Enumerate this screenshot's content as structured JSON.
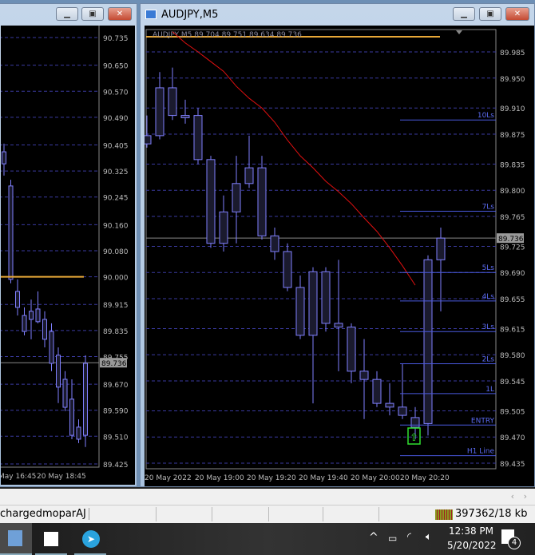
{
  "left_window": {
    "price_labels": [
      "90.735",
      "90.650",
      "90.570",
      "90.490",
      "90.405",
      "90.325",
      "90.245",
      "90.160",
      "90.080",
      "90.000",
      "89.915",
      "89.835",
      "89.755",
      "89.670",
      "89.590",
      "89.510",
      "89.425"
    ],
    "current_price": "89.736",
    "time_labels": [
      "May 16:45",
      "20 May 18:45"
    ],
    "candles": [
      [
        90.384,
        90.409,
        90.311,
        90.347
      ],
      [
        90.279,
        90.298,
        89.98,
        89.992
      ],
      [
        89.955,
        89.992,
        89.881,
        89.906
      ],
      [
        89.881,
        89.906,
        89.82,
        89.832
      ],
      [
        89.894,
        89.93,
        89.808,
        89.869
      ],
      [
        89.901,
        89.955,
        89.857,
        89.862
      ],
      [
        89.869,
        89.894,
        89.783,
        89.808
      ],
      [
        89.832,
        89.857,
        89.71,
        89.734
      ],
      [
        89.759,
        89.783,
        89.612,
        89.661
      ],
      [
        89.685,
        89.71,
        89.587,
        89.599
      ],
      [
        89.624,
        89.685,
        89.501,
        89.513
      ],
      [
        89.538,
        89.562,
        89.489,
        89.501
      ],
      [
        89.734,
        89.759,
        89.477,
        89.513
      ]
    ],
    "orange_level": 90.0
  },
  "main_window": {
    "title": "AUDJPY,M5",
    "ohlc_label": "AUDJPY,M5  89.704 89.751 89.634 89.736",
    "current_price": "89.736",
    "price_labels": [
      "89.985",
      "89.950",
      "89.910",
      "89.875",
      "89.835",
      "89.800",
      "89.765",
      "89.725",
      "89.690",
      "89.655",
      "89.615",
      "89.580",
      "89.545",
      "89.505",
      "89.470",
      "89.435"
    ],
    "time_labels": [
      "20 May 2022",
      "20 May 19:00",
      "20 May 19:20",
      "20 May 19:40",
      "20 May 20:00",
      "20 May 20:20"
    ],
    "candles": [
      [
        89.862,
        89.9,
        89.857,
        89.873
      ],
      [
        89.873,
        89.958,
        89.868,
        89.937
      ],
      [
        89.937,
        89.964,
        89.894,
        89.9
      ],
      [
        89.9,
        89.921,
        89.889,
        89.897
      ],
      [
        89.9,
        89.91,
        89.835,
        89.841
      ],
      [
        89.841,
        89.846,
        89.723,
        89.729
      ],
      [
        89.729,
        89.793,
        89.718,
        89.771
      ],
      [
        89.771,
        89.846,
        89.729,
        89.809
      ],
      [
        89.809,
        89.873,
        89.803,
        89.83
      ],
      [
        89.83,
        89.846,
        89.734,
        89.739
      ],
      [
        89.739,
        89.75,
        89.707,
        89.718
      ],
      [
        89.718,
        89.729,
        89.665,
        89.67
      ],
      [
        89.67,
        89.686,
        89.601,
        89.606
      ],
      [
        89.606,
        89.697,
        89.515,
        89.691
      ],
      [
        89.691,
        89.697,
        89.611,
        89.622
      ],
      [
        89.622,
        89.707,
        89.558,
        89.617
      ],
      [
        89.617,
        89.622,
        89.542,
        89.558
      ],
      [
        89.558,
        89.601,
        89.494,
        89.547
      ],
      [
        89.547,
        89.558,
        89.51,
        89.515
      ],
      [
        89.515,
        89.542,
        89.499,
        89.51
      ],
      [
        89.51,
        89.568,
        89.494,
        89.499
      ],
      [
        89.496,
        89.51,
        89.467,
        89.483
      ],
      [
        89.488,
        89.713,
        89.472,
        89.707
      ],
      [
        89.707,
        89.75,
        89.638,
        89.736
      ]
    ],
    "ma": [
      null,
      null,
      90.012,
      89.997,
      89.985,
      89.972,
      89.959,
      89.939,
      89.923,
      89.91,
      89.891,
      89.867,
      89.846,
      89.83,
      89.812,
      89.798,
      89.782,
      89.763,
      89.745,
      89.723,
      89.699,
      89.673
    ],
    "levels": [
      {
        "label": "10Ls",
        "price": 89.894
      },
      {
        "label": "7Ls",
        "price": 89.772
      },
      {
        "label": "5Ls",
        "price": 89.69
      },
      {
        "label": "4Ls",
        "price": 89.652
      },
      {
        "label": "3Ls",
        "price": 89.611
      },
      {
        "label": "2Ls",
        "price": 89.568
      },
      {
        "label": "1L",
        "price": 89.528
      },
      {
        "label": "ENTRY",
        "price": 89.486
      },
      {
        "label": "H1 Line",
        "price": 89.445
      }
    ],
    "colors": {
      "background": "#000000",
      "candle": "#8080ff",
      "ma": "#e01010",
      "level": "#4a5ae0",
      "orange": "#e8a838"
    }
  },
  "status_bar": {
    "user": "chargedmoparAJ",
    "traffic": "397362/18 kb"
  },
  "taskbar": {
    "time": "12:38 PM",
    "date": "5/20/2022",
    "notifications": "4"
  }
}
